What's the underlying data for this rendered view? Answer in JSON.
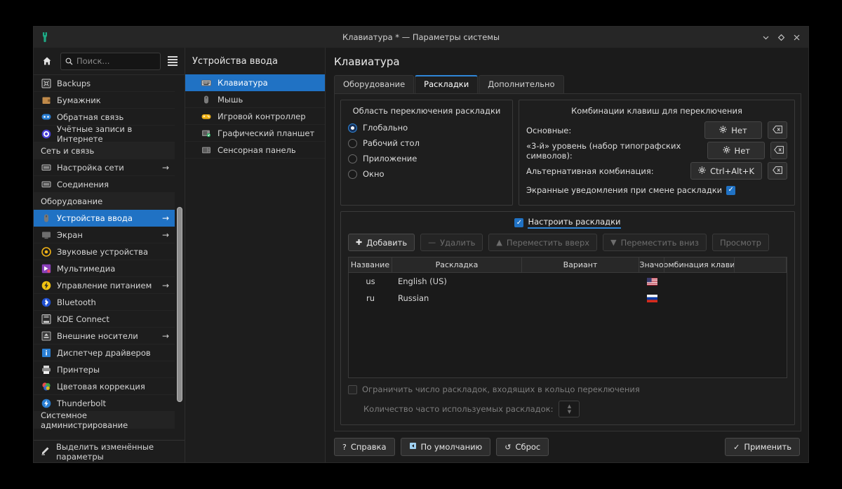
{
  "window": {
    "title": "Клавиатура * — Параметры системы",
    "app_icon": "wrench-icon",
    "controls": {
      "minimize": "minimize-icon",
      "maximize": "maximize-icon",
      "close": "close-icon"
    }
  },
  "sidebar": {
    "home_icon": "home-icon",
    "search_placeholder": "Поиск...",
    "search_value": "",
    "menu_icon": "hamburger-icon",
    "items": [
      {
        "label": "Backups",
        "icon": "backups-icon",
        "type": "item",
        "arrow": false,
        "selected": false
      },
      {
        "label": "Бумажник",
        "icon": "wallet-icon",
        "type": "item",
        "arrow": false,
        "selected": false
      },
      {
        "label": "Обратная связь",
        "icon": "feedback-icon",
        "type": "item",
        "arrow": false,
        "selected": false
      },
      {
        "label": "Учётные записи в Интернете",
        "icon": "online-accounts-icon",
        "type": "item",
        "arrow": false,
        "selected": false
      },
      {
        "label": "Сеть и связь",
        "icon": "",
        "type": "category",
        "arrow": false,
        "selected": false
      },
      {
        "label": "Настройка сети",
        "icon": "network-icon",
        "type": "item",
        "arrow": true,
        "selected": false
      },
      {
        "label": "Соединения",
        "icon": "connections-icon",
        "type": "item",
        "arrow": false,
        "selected": false
      },
      {
        "label": "Оборудование",
        "icon": "",
        "type": "category",
        "arrow": false,
        "selected": false
      },
      {
        "label": "Устройства ввода",
        "icon": "mouse-icon",
        "type": "item",
        "arrow": true,
        "selected": true
      },
      {
        "label": "Экран",
        "icon": "display-icon",
        "type": "item",
        "arrow": true,
        "selected": false
      },
      {
        "label": "Звуковые устройства",
        "icon": "audio-icon",
        "type": "item",
        "arrow": false,
        "selected": false
      },
      {
        "label": "Мультимедиа",
        "icon": "multimedia-icon",
        "type": "item",
        "arrow": false,
        "selected": false
      },
      {
        "label": "Управление питанием",
        "icon": "power-icon",
        "type": "item",
        "arrow": true,
        "selected": false
      },
      {
        "label": "Bluetooth",
        "icon": "bluetooth-icon",
        "type": "item",
        "arrow": false,
        "selected": false
      },
      {
        "label": "KDE Connect",
        "icon": "kdeconnect-icon",
        "type": "item",
        "arrow": false,
        "selected": false
      },
      {
        "label": "Внешние носители",
        "icon": "removable-icon",
        "type": "item",
        "arrow": true,
        "selected": false
      },
      {
        "label": "Диспетчер драйверов",
        "icon": "driver-icon",
        "type": "item",
        "arrow": false,
        "selected": false
      },
      {
        "label": "Принтеры",
        "icon": "printer-icon",
        "type": "item",
        "arrow": false,
        "selected": false
      },
      {
        "label": "Цветовая коррекция",
        "icon": "color-icon",
        "type": "item",
        "arrow": false,
        "selected": false
      },
      {
        "label": "Thunderbolt",
        "icon": "thunderbolt-icon",
        "type": "item",
        "arrow": false,
        "selected": false
      },
      {
        "label": "Системное администрирование",
        "icon": "",
        "type": "category",
        "arrow": false,
        "selected": false
      }
    ],
    "highlight_changed": {
      "label": "Выделить изменённые параметры",
      "icon": "highlighter-icon"
    }
  },
  "modules": {
    "title": "Устройства ввода",
    "items": [
      {
        "label": "Клавиатура",
        "icon": "keyboard-icon",
        "selected": true
      },
      {
        "label": "Мышь",
        "icon": "mouse-icon",
        "selected": false
      },
      {
        "label": "Игровой контроллер",
        "icon": "gamepad-icon",
        "selected": false
      },
      {
        "label": "Графический планшет",
        "icon": "tablet-icon",
        "selected": false
      },
      {
        "label": "Сенсорная панель",
        "icon": "touchpad-icon",
        "selected": false
      }
    ]
  },
  "main": {
    "page_title": "Клавиатура",
    "tabs": [
      {
        "label": "Оборудование",
        "active": false
      },
      {
        "label": "Раскладки",
        "active": true
      },
      {
        "label": "Дополнительно",
        "active": false
      }
    ],
    "switching_policy": {
      "title": "Область переключения раскладки",
      "options": [
        {
          "label": "Глобально",
          "selected": true
        },
        {
          "label": "Рабочий стол",
          "selected": false
        },
        {
          "label": "Приложение",
          "selected": false
        },
        {
          "label": "Окно",
          "selected": false
        }
      ]
    },
    "shortcuts": {
      "title": "Комбинации клавиш для переключения",
      "rows": [
        {
          "label": "Основные:",
          "value": "Нет",
          "gear": true,
          "clear_icon": "clear-icon"
        },
        {
          "label": "«3-й» уровень (набор типографских символов):",
          "value": "Нет",
          "gear": true,
          "clear_icon": "clear-icon"
        },
        {
          "label": "Альтернативная комбинация:",
          "value": "Ctrl+Alt+K",
          "gear": true,
          "clear_icon": "clear-icon"
        }
      ],
      "osd": {
        "label": "Экранные уведомления при смене раскладки",
        "checked": true
      }
    },
    "layouts": {
      "configure": {
        "label": "Настроить раскладки",
        "checked": true,
        "changed": true
      },
      "toolbar": [
        {
          "label": "Добавить",
          "icon": "plus-icon",
          "enabled": true
        },
        {
          "label": "Удалить",
          "icon": "minus-icon",
          "enabled": false
        },
        {
          "label": "Переместить вверх",
          "icon": "arrow-up-icon",
          "enabled": false
        },
        {
          "label": "Переместить вниз",
          "icon": "arrow-down-icon",
          "enabled": false
        },
        {
          "label": "Просмотр",
          "icon": "",
          "enabled": false
        }
      ],
      "columns": [
        "Название",
        "Раскладка",
        "Вариант",
        "Значо",
        "омбинация клави",
        ""
      ],
      "rows": [
        {
          "name": "us",
          "layout": "English (US)",
          "variant": "",
          "flag": "us-flag",
          "shortcut": ""
        },
        {
          "name": "ru",
          "layout": "Russian",
          "variant": "",
          "flag": "ru-flag",
          "shortcut": ""
        }
      ],
      "limit": {
        "label": "Ограничить число раскладок, входящих в кольцо переключения",
        "checked": false,
        "enabled": false
      },
      "count": {
        "label": "Количество часто используемых раскладок:",
        "value": "",
        "enabled": false
      }
    },
    "footer": {
      "help": {
        "label": "Справка",
        "icon": "question-icon"
      },
      "default": {
        "label": "По умолчанию",
        "icon": "defaults-icon"
      },
      "reset": {
        "label": "Сброс",
        "icon": "undo-icon"
      },
      "apply": {
        "label": "Применить",
        "icon": "check-icon"
      }
    }
  },
  "colors": {
    "accent": "#2072c4",
    "tab_accent": "#2f86d8",
    "window_bg": "#1b1b1b",
    "sidebar_bg": "#1d1d1d",
    "titlebar_bg": "#262626"
  }
}
